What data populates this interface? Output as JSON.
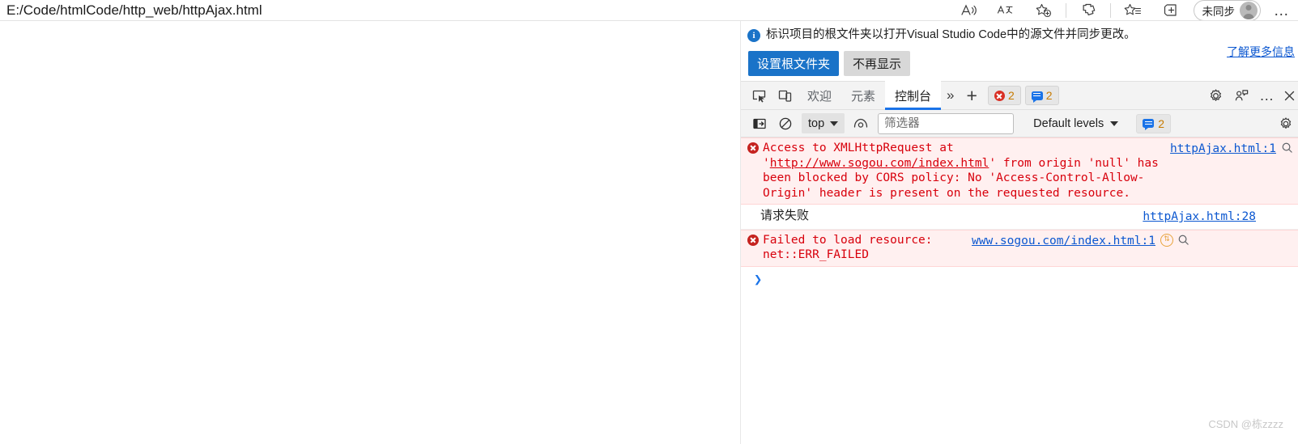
{
  "browser": {
    "url": "E:/Code/htmlCode/http_web/httpAjax.html",
    "toolbar_icons": [
      {
        "name": "read-aloud-icon",
        "glyph": "A"
      },
      {
        "name": "translate-icon",
        "glyph": "aあ"
      },
      {
        "name": "add-favorite-icon",
        "glyph": "star-plus"
      },
      {
        "name": "collections-icon",
        "glyph": "collections"
      },
      {
        "name": "favorites-icon",
        "glyph": "star-list"
      },
      {
        "name": "split-screen-icon",
        "glyph": "split"
      }
    ],
    "profile": {
      "label": "未同步",
      "avatar_name": "profile-avatar"
    },
    "settings_more_label": "…"
  },
  "banner": {
    "info_text": "标识项目的根文件夹以打开Visual Studio Code中的源文件并同步更改。",
    "learn_more": "了解更多信息",
    "primary_button": "设置根文件夹",
    "secondary_button": "不再显示"
  },
  "devtools": {
    "tabs": [
      {
        "label": "欢迎",
        "active": false
      },
      {
        "label": "元素",
        "active": false
      },
      {
        "label": "控制台",
        "active": true
      }
    ],
    "overflow_label": "»",
    "add_tab_label": "+",
    "error_badge_count": "2",
    "message_badge_count": "2",
    "icons": {
      "inspect": "inspect-element-icon",
      "device": "device-toolbar-icon",
      "settings": "settings-gear-icon",
      "feedback": "feedback-icon",
      "more": "…",
      "close": "close-devtools-icon"
    }
  },
  "console_toolbar": {
    "sidebar_toggle": "console-sidebar-icon",
    "clear_console": "clear-console-icon",
    "context": "top",
    "eye_icon": "live-expression-icon",
    "filter_placeholder": "筛选器",
    "filter_value": "",
    "levels": "Default levels",
    "badge_count": "2",
    "settings_icon": "console-settings-icon"
  },
  "console_messages": [
    {
      "type": "error",
      "text_parts": [
        {
          "t": "Access to XMLHttpRequest at '",
          "link": false
        },
        {
          "t": "http://www.sogou.com/index.html",
          "link": true
        },
        {
          "t": "' from origin 'null' has been blocked by CORS policy: No 'Access-Control-Allow-Origin' header is present on the requested resource.",
          "link": false
        }
      ],
      "source": "httpAjax.html:1",
      "has_search_icon": true,
      "has_net_icon": false
    },
    {
      "type": "log",
      "text": "请求失败",
      "source": "httpAjax.html:28",
      "has_search_icon": false,
      "has_net_icon": false
    },
    {
      "type": "error",
      "text": "Failed to load resource: net::ERR_FAILED",
      "source": "www.sogou.com/index.html:1",
      "has_search_icon": true,
      "has_net_icon": true
    }
  ],
  "prompt": {
    "chevron": "❯"
  },
  "watermark": "CSDN @栋zzzz",
  "colors": {
    "accent": "#1a73e8",
    "error": "#d8000c",
    "link": "#0b57d0",
    "primary_button": "#1a73c8"
  }
}
